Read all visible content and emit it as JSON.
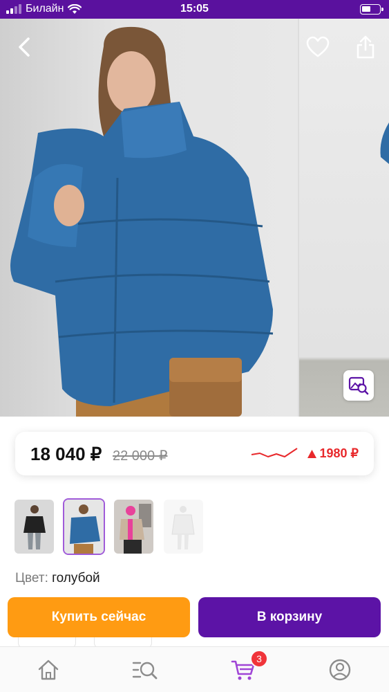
{
  "status_bar": {
    "carrier": "Билайн",
    "time": "15:05"
  },
  "gallery": {
    "current_photo": "blue-puffer-jacket-photo",
    "next_photo": "product-photo-2"
  },
  "price": {
    "current": "18 040 ₽",
    "old": "22 000 ₽",
    "change": "1980 ₽",
    "trend_color": "#e8282b"
  },
  "thumbnails": [
    {
      "name": "black-jacket",
      "selected": false
    },
    {
      "name": "blue-jacket",
      "selected": true
    },
    {
      "name": "beige-jacket",
      "selected": false
    },
    {
      "name": "white-jacket",
      "selected": false
    }
  ],
  "color": {
    "label": "Цвет:",
    "value": "голубой"
  },
  "actions": {
    "buy_now": "Купить сейчас",
    "add_to_cart": "В корзину",
    "buy_color": "#ff9b12",
    "cart_color": "#5c13a6"
  },
  "tabbar": {
    "items": [
      "home-icon",
      "catalog-search-icon",
      "cart-icon",
      "profile-icon"
    ],
    "cart_badge": "3",
    "active": "cart-icon"
  }
}
